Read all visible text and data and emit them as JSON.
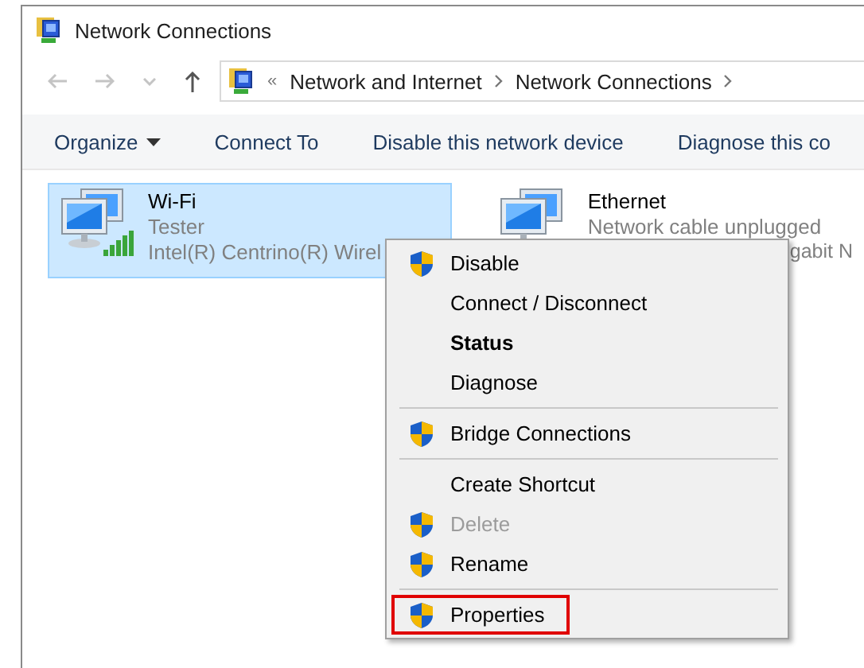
{
  "window": {
    "title": "Network Connections"
  },
  "address": {
    "overflow": "«",
    "crumbs": [
      "Network and Internet",
      "Network Connections"
    ]
  },
  "toolbar": [
    {
      "label": "Organize",
      "dropdown": true
    },
    {
      "label": "Connect To",
      "dropdown": false
    },
    {
      "label": "Disable this network device",
      "dropdown": false
    },
    {
      "label": "Diagnose this co",
      "dropdown": false
    }
  ],
  "connections": [
    {
      "kind": "wifi",
      "name": "Wi-Fi",
      "status": "Tester",
      "device": "Intel(R) Centrino(R) Wirel",
      "selected": true
    },
    {
      "kind": "wired",
      "name": "Ethernet",
      "status": "Network cable unplugged",
      "device": "gabit N",
      "selected": false
    }
  ],
  "context_menu": [
    {
      "kind": "item",
      "label": "Disable",
      "shield": true,
      "bold": false,
      "disabled": false,
      "highlighted": false
    },
    {
      "kind": "item",
      "label": "Connect / Disconnect",
      "shield": false,
      "bold": false,
      "disabled": false,
      "highlighted": false
    },
    {
      "kind": "item",
      "label": "Status",
      "shield": false,
      "bold": true,
      "disabled": false,
      "highlighted": false
    },
    {
      "kind": "item",
      "label": "Diagnose",
      "shield": false,
      "bold": false,
      "disabled": false,
      "highlighted": false
    },
    {
      "kind": "separator"
    },
    {
      "kind": "item",
      "label": "Bridge Connections",
      "shield": true,
      "bold": false,
      "disabled": false,
      "highlighted": false
    },
    {
      "kind": "separator"
    },
    {
      "kind": "item",
      "label": "Create Shortcut",
      "shield": false,
      "bold": false,
      "disabled": false,
      "highlighted": false
    },
    {
      "kind": "item",
      "label": "Delete",
      "shield": true,
      "bold": false,
      "disabled": true,
      "highlighted": false
    },
    {
      "kind": "item",
      "label": "Rename",
      "shield": true,
      "bold": false,
      "disabled": false,
      "highlighted": false
    },
    {
      "kind": "separator"
    },
    {
      "kind": "item",
      "label": "Properties",
      "shield": true,
      "bold": false,
      "disabled": false,
      "highlighted": true
    }
  ]
}
